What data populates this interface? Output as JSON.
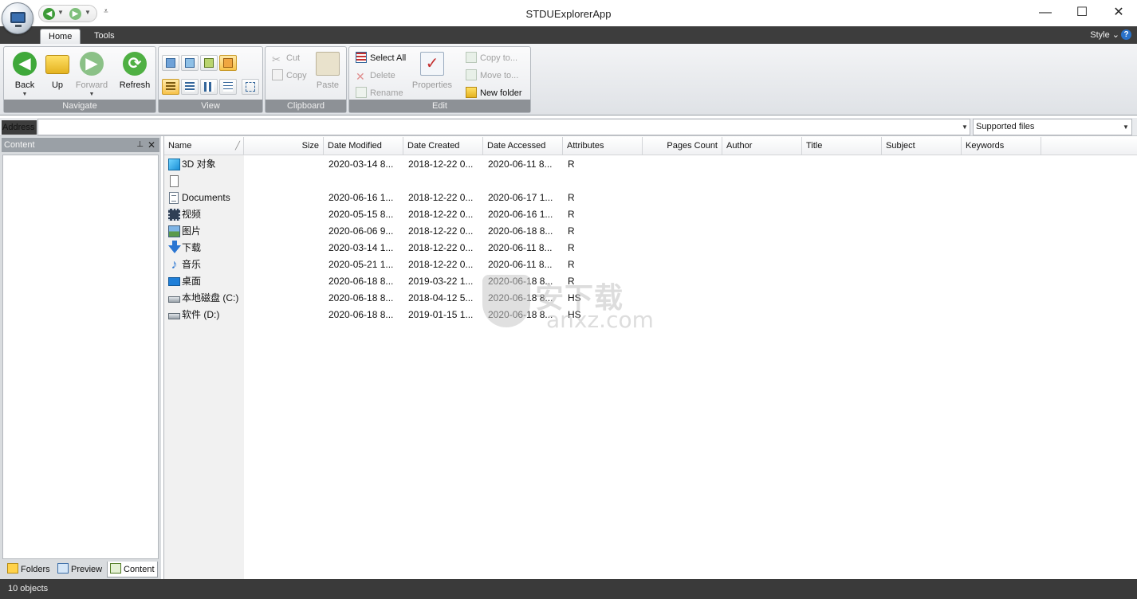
{
  "window": {
    "title": "STDUExplorerApp",
    "minimize_glyph": "—",
    "maximize_glyph": "☐",
    "close_glyph": "✕",
    "customize_glyph": "⩡"
  },
  "tabs": [
    {
      "label": "Home",
      "active": true
    },
    {
      "label": "Tools",
      "active": false
    }
  ],
  "style_menu": "Style",
  "help_glyph": "?",
  "ribbon": {
    "navigate": {
      "label": "Navigate",
      "back": "Back",
      "up": "Up",
      "forward": "Forward",
      "refresh": "Refresh"
    },
    "view": {
      "label": "View"
    },
    "clipboard": {
      "label": "Clipboard",
      "cut": "Cut",
      "copy": "Copy",
      "paste": "Paste"
    },
    "edit": {
      "label": "Edit",
      "select_all": "Select All",
      "delete": "Delete",
      "rename": "Rename",
      "properties": "Properties",
      "copy_to": "Copy to...",
      "move_to": "Move to...",
      "new_folder": "New folder"
    }
  },
  "address": {
    "label": "Address",
    "value": "",
    "filter": "Supported files"
  },
  "left_panel": {
    "title": "Content",
    "pin_glyph": "⊥",
    "close_glyph": "✕",
    "tabs": [
      {
        "label": "Folders"
      },
      {
        "label": "Preview"
      },
      {
        "label": "Content"
      }
    ]
  },
  "columns": [
    "Name",
    "Size",
    "Date Modified",
    "Date Created",
    "Date Accessed",
    "Attributes",
    "Pages Count",
    "Author",
    "Title",
    "Subject",
    "Keywords"
  ],
  "rows": [
    {
      "name": "3D 对象",
      "icon": "3d-objects-icon",
      "size": "",
      "modified": "2020-03-14 8...",
      "created": "2018-12-22 0...",
      "accessed": "2020-06-11 8...",
      "attributes": "R"
    },
    {
      "name": "",
      "icon": "file-icon",
      "size": "",
      "modified": "",
      "created": "",
      "accessed": "",
      "attributes": ""
    },
    {
      "name": "Documents",
      "icon": "documents-icon",
      "size": "",
      "modified": "2020-06-16 1...",
      "created": "2018-12-22 0...",
      "accessed": "2020-06-17 1...",
      "attributes": "R"
    },
    {
      "name": "视频",
      "icon": "video-icon",
      "size": "",
      "modified": "2020-05-15 8...",
      "created": "2018-12-22 0...",
      "accessed": "2020-06-16 1...",
      "attributes": "R"
    },
    {
      "name": "图片",
      "icon": "pictures-icon",
      "size": "",
      "modified": "2020-06-06 9...",
      "created": "2018-12-22 0...",
      "accessed": "2020-06-18 8...",
      "attributes": "R"
    },
    {
      "name": "下载",
      "icon": "downloads-icon",
      "size": "",
      "modified": "2020-03-14 1...",
      "created": "2018-12-22 0...",
      "accessed": "2020-06-11 8...",
      "attributes": "R"
    },
    {
      "name": "音乐",
      "icon": "music-icon",
      "size": "",
      "modified": "2020-05-21 1...",
      "created": "2018-12-22 0...",
      "accessed": "2020-06-11 8...",
      "attributes": "R"
    },
    {
      "name": "桌面",
      "icon": "desktop-icon",
      "size": "",
      "modified": "2020-06-18 8...",
      "created": "2019-03-22 1...",
      "accessed": "2020-06-18 8...",
      "attributes": "R"
    },
    {
      "name": "本地磁盘 (C:)",
      "icon": "drive-c-icon",
      "size": "",
      "modified": "2020-06-18 8...",
      "created": "2018-04-12 5...",
      "accessed": "2020-06-18 8...",
      "attributes": "HS"
    },
    {
      "name": "软件 (D:)",
      "icon": "drive-d-icon",
      "size": "",
      "modified": "2020-06-18 8...",
      "created": "2019-01-15 1...",
      "accessed": "2020-06-18 8...",
      "attributes": "HS"
    }
  ],
  "watermark": {
    "line1": "安下载",
    "line2": "anxz.com"
  },
  "status": "10 objects"
}
